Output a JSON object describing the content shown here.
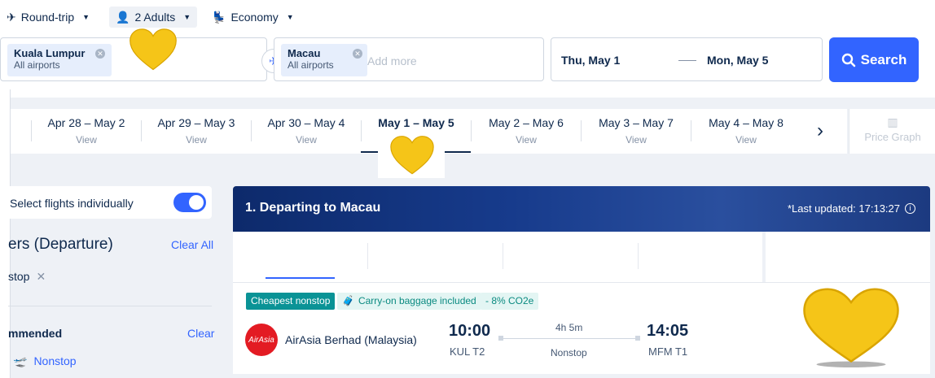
{
  "search_options": {
    "trip_type": "Round-trip",
    "passengers": "2 Adults",
    "cabin": "Economy"
  },
  "search_form": {
    "origin": {
      "city": "Kuala Lumpur",
      "airports": "All airports"
    },
    "destination": {
      "city": "Macau",
      "airports": "All airports"
    },
    "add_more_placeholder": "Add more",
    "depart_date": "Thu, May 1",
    "return_date": "Mon, May 5",
    "search_label": "Search"
  },
  "date_tabs": [
    {
      "dates": "Apr 28 – May 2",
      "price": "View"
    },
    {
      "dates": "Apr 29 – May 3",
      "price": "View"
    },
    {
      "dates": "Apr 30 – May 4",
      "price": "View"
    },
    {
      "dates": "May 1 – May 5",
      "price": "",
      "selected": true
    },
    {
      "dates": "May 2 – May 6",
      "price": "View"
    },
    {
      "dates": "May 3 – May 7",
      "price": "View"
    },
    {
      "dates": "May 4 – May 8",
      "price": "View"
    }
  ],
  "price_graph_label": "Price Graph",
  "filters": {
    "individual_toggle_label": "Select flights individually",
    "individual_toggle_on": true,
    "title": "ers (Departure)",
    "clear_all": "Clear All",
    "active_chip": "stop",
    "recommended_title": "mmended",
    "recommended_clear": "Clear",
    "nonstop_option": "Nonstop"
  },
  "results": {
    "banner_title": "1. Departing to Macau",
    "last_updated": "*Last updated: 17:13:27",
    "tags": {
      "cheapest": "Cheapest nonstop",
      "baggage": "Carry-on baggage included",
      "co2": "- 8% CO2e"
    },
    "flight": {
      "airline_logo_text": "AirAsia",
      "airline": "AirAsia Berhad (Malaysia)",
      "depart_time": "10:00",
      "depart_airport": "KUL T2",
      "duration": "4h 5m",
      "stops": "Nonstop",
      "arrive_time": "14:05",
      "arrive_airport": "MFM T1"
    }
  },
  "colors": {
    "accent": "#3264ff",
    "navy": "#0f294d",
    "teal": "#0a9396",
    "heart": "#f5c518",
    "airasia_red": "#e31b23"
  }
}
